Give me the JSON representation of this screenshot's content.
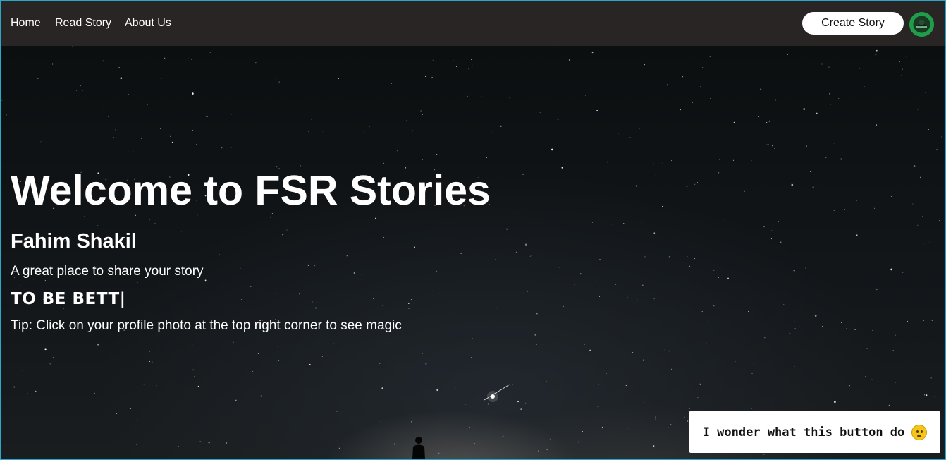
{
  "nav": {
    "links": [
      {
        "label": "Home",
        "icon": ""
      },
      {
        "label": "Read Story",
        "icon": ""
      },
      {
        "label": "About Us",
        "icon": ""
      }
    ],
    "create_button": "Create Story",
    "avatar_icon": "profile-avatar"
  },
  "hero": {
    "title": "Welcome to FSR Stories",
    "author": "Fahim Shakil",
    "tagline": "A great place to share your story",
    "typing_text": "TO BE BETT|",
    "tip": "Tip: Click on your profile photo at the top right corner to see magic",
    "background": "starry-night-sky"
  },
  "floating_button": {
    "label": "I wonder what this button do",
    "icon": "smiling-emoji-icon"
  },
  "colors": {
    "navbar": "#292524",
    "accent_border": "#2aa7c9",
    "avatar_green": "#22c55e"
  }
}
